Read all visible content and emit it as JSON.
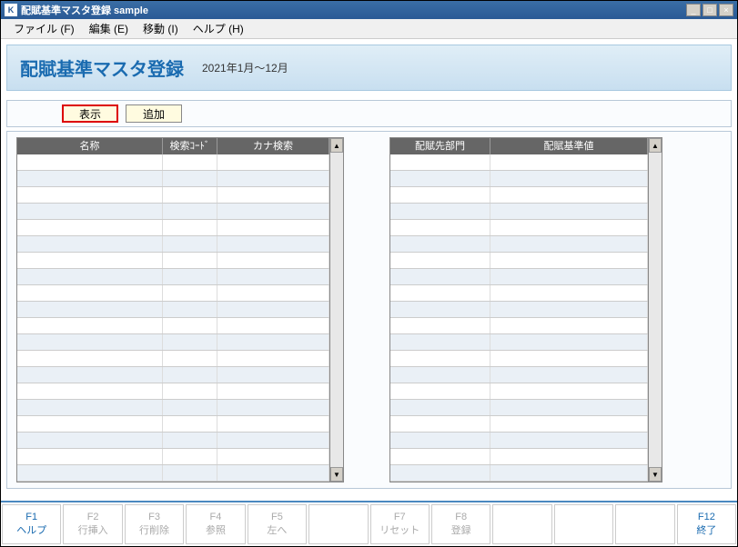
{
  "window": {
    "title": "配賦基準マスタ登録 sample",
    "icon_letter": "K"
  },
  "menubar": [
    {
      "label": "ファイル",
      "accel": "(F)"
    },
    {
      "label": "編集",
      "accel": "(E)"
    },
    {
      "label": "移動",
      "accel": "(I)"
    },
    {
      "label": "ヘルプ",
      "accel": "(H)"
    }
  ],
  "header": {
    "title": "配賦基準マスタ登録",
    "date_range": "2021年1月～12月"
  },
  "toolbar": {
    "display_btn": "表示",
    "add_btn": "追加"
  },
  "left_table": {
    "headers": [
      "名称",
      "検索ｺｰﾄﾞ",
      "カナ検索"
    ],
    "rows": 20
  },
  "right_table": {
    "headers": [
      "配賦先部門",
      "配賦基準値"
    ],
    "rows": 20
  },
  "fkeys": [
    {
      "num": "F1",
      "label": "ヘルプ",
      "active": true
    },
    {
      "num": "F2",
      "label": "行挿入",
      "active": false
    },
    {
      "num": "F3",
      "label": "行削除",
      "active": false
    },
    {
      "num": "F4",
      "label": "参照",
      "active": false
    },
    {
      "num": "F5",
      "label": "左へ",
      "active": false
    },
    {
      "num": "",
      "label": "",
      "active": false
    },
    {
      "num": "F7",
      "label": "リセット",
      "active": false
    },
    {
      "num": "F8",
      "label": "登録",
      "active": false
    },
    {
      "num": "",
      "label": "",
      "active": false
    },
    {
      "num": "",
      "label": "",
      "active": false
    },
    {
      "num": "",
      "label": "",
      "active": false
    },
    {
      "num": "F12",
      "label": "終了",
      "active": true
    }
  ]
}
